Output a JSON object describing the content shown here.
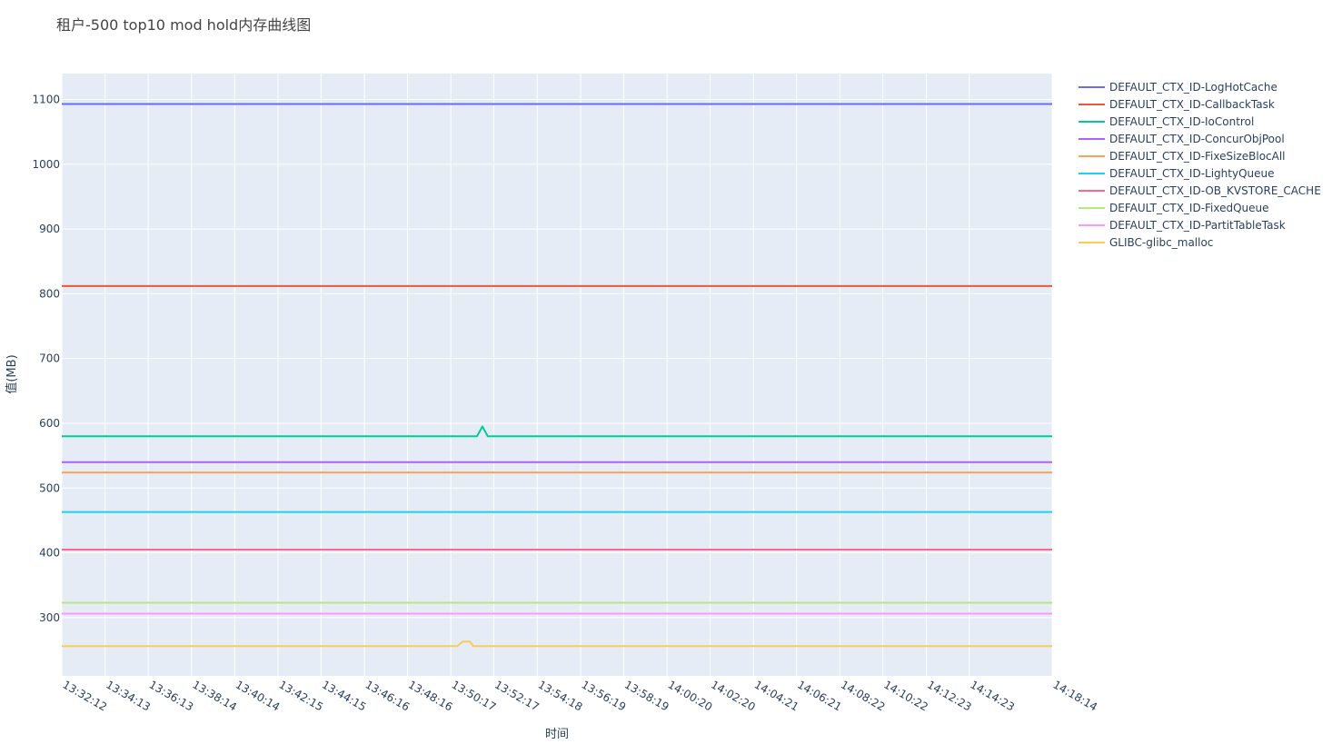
{
  "chart_data": {
    "type": "line",
    "title": "租户-500 top10 mod hold内存曲线图",
    "xlabel": "时间",
    "ylabel": "值(MB)",
    "ylim": [
      210,
      1140
    ],
    "y_ticks": [
      300,
      400,
      500,
      600,
      700,
      800,
      900,
      1000,
      1100
    ],
    "x_range": [
      "13:32:12",
      "14:18:14"
    ],
    "x_tick_labels": [
      "13:32:12",
      "13:34:13",
      "13:36:13",
      "13:38:14",
      "13:40:14",
      "13:42:15",
      "13:44:15",
      "13:46:16",
      "13:48:16",
      "13:50:17",
      "13:52:17",
      "13:54:18",
      "13:56:19",
      "13:58:19",
      "14:00:20",
      "14:02:20",
      "14:04:21",
      "14:06:21",
      "14:08:22",
      "14:10:22",
      "14:12:23",
      "14:14:23",
      "14:18:14"
    ],
    "grid": true,
    "legend_position": "right",
    "plot_background": "#e5ecf6",
    "series": [
      {
        "name": "DEFAULT_CTX_ID-LogHotCache",
        "color": "#636efa",
        "points": [
          [
            "13:32:12",
            1093
          ],
          [
            "14:18:14",
            1093
          ]
        ]
      },
      {
        "name": "DEFAULT_CTX_ID-CallbackTask",
        "color": "#ef553b",
        "points": [
          [
            "13:32:12",
            812
          ],
          [
            "14:18:14",
            812
          ]
        ]
      },
      {
        "name": "DEFAULT_CTX_ID-IoControl",
        "color": "#00cc96",
        "points": [
          [
            "13:32:12",
            580
          ],
          [
            "13:51:30",
            580
          ],
          [
            "13:51:45",
            595
          ],
          [
            "13:52:00",
            580
          ],
          [
            "14:18:14",
            580
          ]
        ]
      },
      {
        "name": "DEFAULT_CTX_ID-ConcurObjPool",
        "color": "#ab63fa",
        "points": [
          [
            "13:32:12",
            540
          ],
          [
            "14:18:14",
            540
          ]
        ]
      },
      {
        "name": "DEFAULT_CTX_ID-FixeSizeBlocAll",
        "color": "#ffa15a",
        "points": [
          [
            "13:32:12",
            524
          ],
          [
            "14:18:14",
            524
          ]
        ]
      },
      {
        "name": "DEFAULT_CTX_ID-LightyQueue",
        "color": "#19d3f3",
        "points": [
          [
            "13:32:12",
            463
          ],
          [
            "14:18:14",
            463
          ]
        ]
      },
      {
        "name": "DEFAULT_CTX_ID-OB_KVSTORE_CACHE",
        "color": "#ff6692",
        "points": [
          [
            "13:32:12",
            405
          ],
          [
            "14:18:14",
            405
          ]
        ]
      },
      {
        "name": "DEFAULT_CTX_ID-FixedQueue",
        "color": "#b6e880",
        "points": [
          [
            "13:32:12",
            323
          ],
          [
            "14:18:14",
            323
          ]
        ]
      },
      {
        "name": "DEFAULT_CTX_ID-PartitTableTask",
        "color": "#ff97ff",
        "points": [
          [
            "13:32:12",
            306
          ],
          [
            "14:18:14",
            306
          ]
        ]
      },
      {
        "name": "GLIBC-glibc_malloc",
        "color": "#fecb52",
        "points": [
          [
            "13:32:12",
            256
          ],
          [
            "13:50:35",
            256
          ],
          [
            "13:50:50",
            263
          ],
          [
            "13:51:10",
            263
          ],
          [
            "13:51:20",
            256
          ],
          [
            "14:18:14",
            256
          ]
        ]
      }
    ]
  }
}
